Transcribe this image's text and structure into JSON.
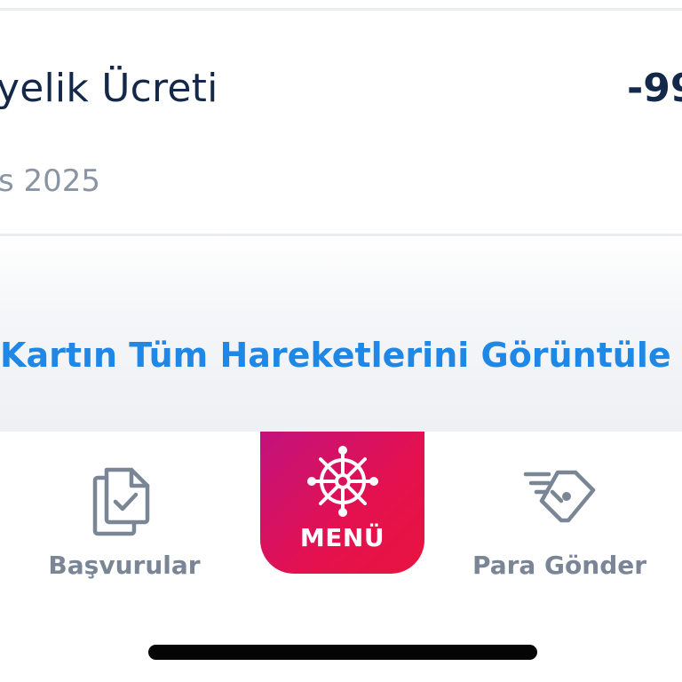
{
  "transaction": {
    "title": "yelik Ücreti",
    "amount": "-99",
    "date": "s 2025"
  },
  "view_all": {
    "label": "Kartın Tüm Hareketlerini Görüntüle"
  },
  "tabbar": {
    "basvurular": {
      "label": "Başvurular",
      "icon": "document-check-icon"
    },
    "menu": {
      "label": "MENÜ",
      "icon": "ship-wheel-icon"
    },
    "para_gonder": {
      "label": "Para Gönder",
      "icon": "money-transfer-icon"
    }
  },
  "colors": {
    "title": "#14284a",
    "muted": "#8a95a4",
    "link": "#1f87e5",
    "tab_inactive": "#7a8696",
    "menu_gradient_start": "#c2127d",
    "menu_gradient_end": "#e8143f"
  }
}
